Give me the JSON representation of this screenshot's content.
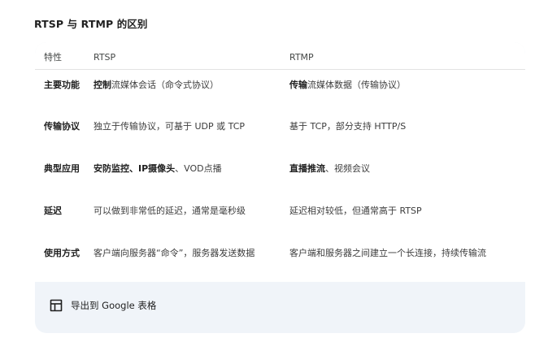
{
  "heading": "RTSP 与 RTMP 的区别",
  "table": {
    "headers": [
      "特性",
      "RTSP",
      "RTMP"
    ],
    "rows": [
      {
        "feature": "主要功能",
        "rtsp_bold": "控制",
        "rtsp_rest": "流媒体会话（命令式协议）",
        "rtmp_bold": "传输",
        "rtmp_rest": "流媒体数据（传输协议）"
      },
      {
        "feature": "传输协议",
        "rtsp_bold": "",
        "rtsp_rest": "独立于传输协议，可基于 UDP 或 TCP",
        "rtmp_bold": "",
        "rtmp_rest": "基于 TCP，部分支持 HTTP/S"
      },
      {
        "feature": "典型应用",
        "rtsp_bold": "安防监控、IP摄像头",
        "rtsp_rest": "、VOD点播",
        "rtmp_bold": "直播推流",
        "rtmp_rest": "、视频会议"
      },
      {
        "feature": "延迟",
        "rtsp_bold": "",
        "rtsp_rest": "可以做到非常低的延迟，通常是毫秒级",
        "rtmp_bold": "",
        "rtmp_rest": "延迟相对较低，但通常高于 RTSP"
      },
      {
        "feature": "使用方式",
        "rtsp_bold": "",
        "rtsp_rest": "客户端向服务器“命令”，服务器发送数据",
        "rtmp_bold": "",
        "rtmp_rest": "客户端和服务器之间建立一个长连接，持续传输流"
      }
    ]
  },
  "footer": {
    "export_label": "导出到 Google 表格",
    "icon": "table-grid-icon"
  },
  "colors": {
    "card_background": "#f0f4f9",
    "text": "#1f1f1f",
    "muted_text": "#444746",
    "divider": "#e3e3e3"
  }
}
